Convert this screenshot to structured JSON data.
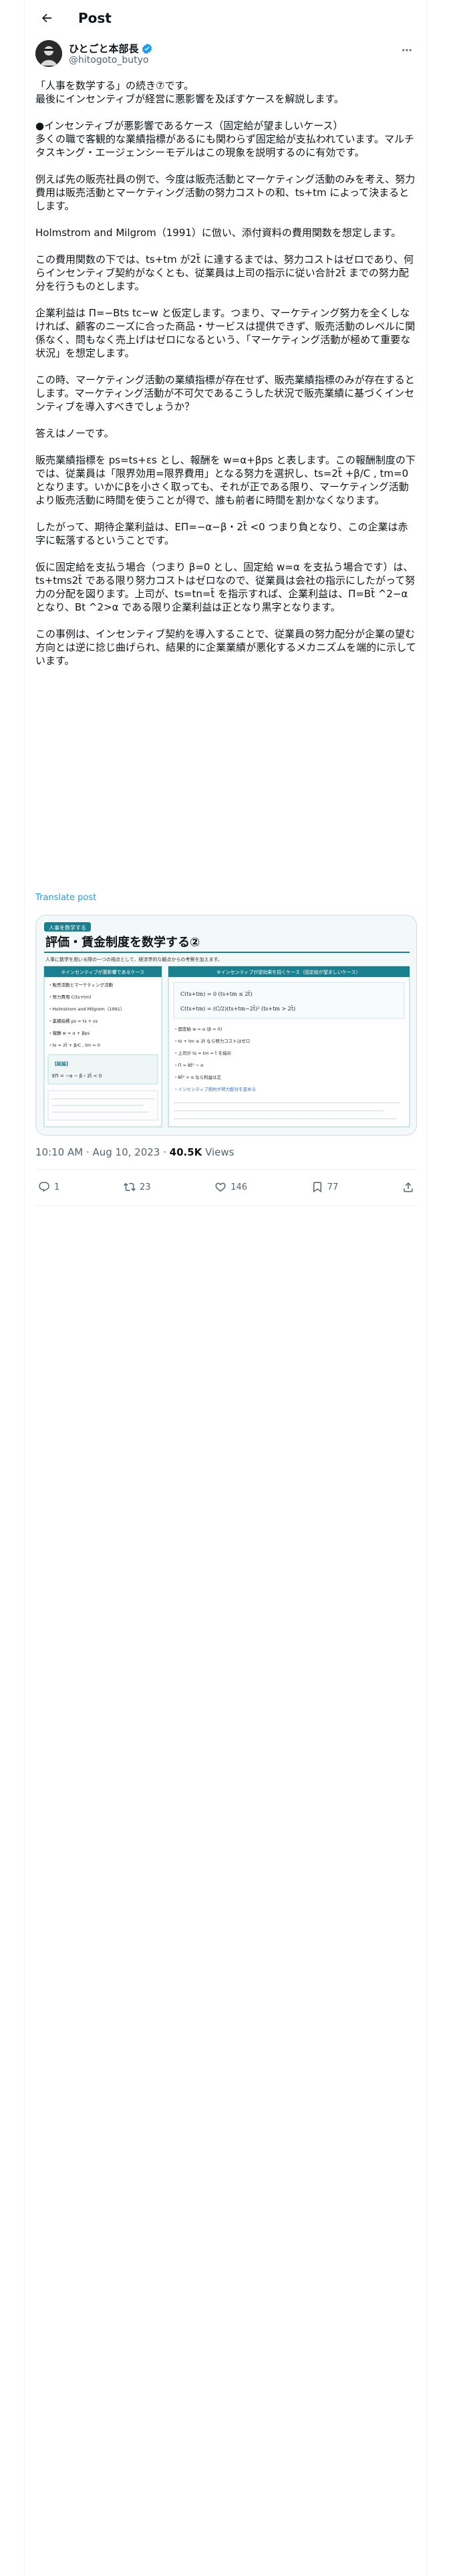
{
  "header": {
    "title": "Post"
  },
  "author": {
    "display_name": "ひとごと本部長",
    "handle": "@hitogoto_butyo"
  },
  "tweet": {
    "paragraphs": [
      "「人事を数学する」の続き⑦です。\n最後にインセンティブが経営に悪影響を及ぼすケースを解説します。",
      "●インセンティブが悪影響であるケース（固定給が望ましいケース）\n多くの職で客観的な業績指標があるにも関わらず固定給が支払われています。マルチタスキング・エージェンシーモデルはこの現象を説明するのに有効です。",
      "例えば先の販売社員の例で、今度は販売活動とマーケティング活動のみを考え、努力費用は販売活動とマーケティング活動の努力コストの和、ts+tm によって決まるとします。",
      "Holmstrom and Milgrom（1991）に倣い、添付資料の費用関数を想定します。",
      "この費用関数の下では、ts+tm が2t̄ に達するまでは、努力コストはゼロであり、何らインセンティブ契約がなくとも、従業員は上司の指示に従い合計2t̄ までの努力配分を行うものとします。",
      "企業利益は Π=−Bts tc−w と仮定します。つまり、マーケティング努力を全くしなければ、顧客のニーズに合った商品・サービスは提供できず、販売活動のレベルに関係なく、問もなく売上げはゼロになるという、「マーケティング活動が極めて重要な状況」を想定します。",
      "この時、マーケティング活動の業績指標が存在せず、販売業績指標のみが存在するとします。マーケティング活動が不可欠であるこうした状況で販売業績に基づくインセンティブを導入すべきでしょうか？",
      "答えはノーです。",
      "販売業績指標を ps=ts+εs とし、報酬を w=α+βps と表します。この報酬制度の下では、従業員は「限界効用=限界費用」となる努力を選択し、ts=2t̄ +β/C , tm=0 となります。いかにβを小さく取っても、それが正である限り、マーケティング活動より販売活動に時間を使うことが得で、誰も前者に時間を割かなくなります。",
      "したがって、期待企業利益は、EΠ=−α−β・2t̄ <0 つまり負となり、この企業は赤字に転落するということです。",
      "仮に固定給を支払う場合（つまり β=0 とし、固定給 w=α を支払う場合です）は、ts+tms2t̄ である限り努力コストはゼロなので、従業員は会社の指示にしたがって努力の分配を図ります。上司が、ts=tn=t̄ を指示すれば、企業利益は、Π=Bt̄ ^2−α となり、Bt ^2>α である限り企業利益は正となり黒字となります。",
      "この事例は、インセンティブ契約を導入することで、従業員の努力配分が企業の望む方向とは逆に捻じ曲げられ、結果的に企業業績が悪化するメカニズムを端的に示しています。"
    ],
    "translate_label": "Translate post"
  },
  "media": {
    "header_tag": "人事を数学する",
    "title": "評価・賃金制度を数学する②",
    "subtitle": "人事に数学を用いる際の一つの視点として、経済学的な観点からの考察を加えます。",
    "left_heading": "②インセンティブが悪影響であるケース",
    "right_heading": "⑥インセンティブが逆効果を招くケース（固定給が望ましいケース）",
    "left_lines": [
      "・販売活動とマーケティング活動",
      "・努力費用 C(ts+tm)",
      "・Holmstrom and Milgrom（1991）",
      "・業績指標 ps = ts + εs",
      "・報酬 w = α + βps",
      "・ts = 2t̄ + β/C , tm = 0",
      "【結論】",
      "EΠ = −α − β・2t̄ < 0"
    ],
    "right_lines": [
      "・固定給 w = α (β = 0)",
      "・ts + tm ≤ 2t̄ なら努力コストはゼロ",
      "・上司が ts = tm = t̄ を指示",
      "・Π = Bt̄² − α",
      "・Bt̄² > α なら利益は正",
      "・インセンティブ契約が努力配分を歪める"
    ],
    "formula_left": "C(ts+tm) = 0 (ts+tm ≤ 2t̄)",
    "formula_right": "C(ts+tm) = (C/2)(ts+tm−2t̄)² (ts+tm > 2t̄)"
  },
  "meta": {
    "time": "10:10 AM · Aug 10, 2023 · ",
    "views_count": "40.5K",
    "views_label": " Views"
  },
  "actions": {
    "replies": "1",
    "reposts": "23",
    "likes": "146",
    "bookmarks": "77"
  },
  "colors": {
    "accent": "#1d9bf0",
    "text": "#0f1419",
    "muted": "#536471",
    "doc_teal": "#1a7f8e",
    "doc_blue": "#2c6fbf"
  }
}
